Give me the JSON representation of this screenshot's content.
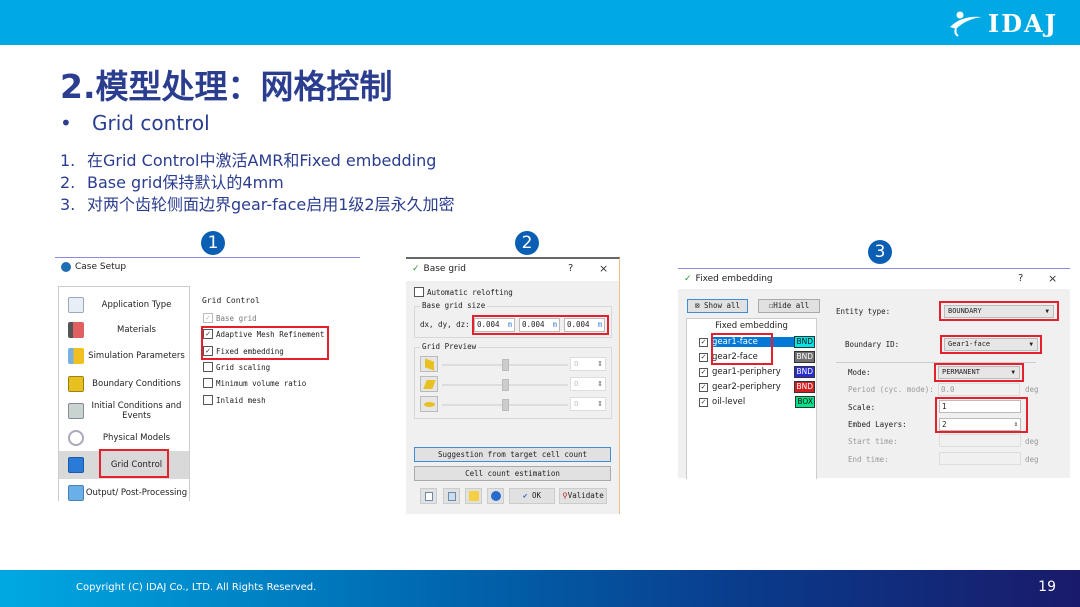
{
  "header": {
    "logo_text": "IDAJ",
    "brand_color": "#00a9e3"
  },
  "slide": {
    "title": "2.模型处理：网格控制",
    "bullet": "Grid control",
    "bullet_marker": "•",
    "steps": [
      {
        "num": "1.",
        "text": "在Grid Control中激活AMR和Fixed embedding"
      },
      {
        "num": "2.",
        "text": "Base grid保持默认的4mm"
      },
      {
        "num": "3.",
        "text": "对两个齿轮侧面边界gear-face启用1级2层永久加密"
      }
    ],
    "badges": [
      "1",
      "2",
      "3"
    ]
  },
  "case_setup": {
    "title": "Case Setup",
    "sidebar": [
      {
        "label": "Application Type",
        "icon": "notepad-icon"
      },
      {
        "label": "Materials",
        "icon": "materials-icon"
      },
      {
        "label": "Simulation Parameters",
        "icon": "folder-icon"
      },
      {
        "label": "Boundary Conditions",
        "icon": "box-icon"
      },
      {
        "label": "Initial Conditions and Events",
        "icon": "calculator-icon"
      },
      {
        "label": "Physical Models",
        "icon": "chain-icon"
      },
      {
        "label": "Grid Control",
        "icon": "grid-icon",
        "selected": true
      },
      {
        "label": "Output/ Post-Processing",
        "icon": "monitor-icon"
      }
    ],
    "group_title": "Grid Control",
    "options": [
      {
        "label": "Base grid",
        "checked": true,
        "disabled": true
      },
      {
        "label": "Adaptive Mesh Refinement",
        "checked": true
      },
      {
        "label": "Fixed embedding",
        "checked": true
      },
      {
        "label": "Grid scaling",
        "checked": false
      },
      {
        "label": "Minimum volume ratio",
        "checked": false
      },
      {
        "label": "Inlaid mesh",
        "checked": false
      }
    ]
  },
  "base_grid": {
    "title": "Base grid",
    "help": "?",
    "close": "×",
    "auto_relofting": "Automatic relofting",
    "size_group": "Base grid size",
    "size_label": "dx, dy, dz:",
    "dx": "0.004",
    "dy": "0.004",
    "dz": "0.004",
    "unit": "m",
    "preview_group": "Grid Preview",
    "preview_values": [
      "0",
      "0",
      "0"
    ],
    "preview_positions": [
      0.5,
      0.5,
      0.5
    ],
    "suggest_btn": "Suggestion from target cell count",
    "estimate_btn": "Cell count estimation",
    "ok_btn": "OK",
    "validate_btn": "Validate"
  },
  "fixed_embedding": {
    "title": "Fixed embedding",
    "help": "?",
    "close": "×",
    "show_all": "Show all",
    "hide_all": "Hide all",
    "list_header": "Fixed embedding",
    "items": [
      {
        "name": "gear1-face",
        "tag": "BND",
        "tag_color": "#00e5e5",
        "selected": true
      },
      {
        "name": "gear2-face",
        "tag": "BND",
        "tag_color": "#707070"
      },
      {
        "name": "gear1-periphery",
        "tag": "BND",
        "tag_color": "#2a2ad0"
      },
      {
        "name": "gear2-periphery",
        "tag": "BND",
        "tag_color": "#d02020"
      },
      {
        "name": "oil-level",
        "tag": "BOX",
        "tag_color": "#00e58a"
      }
    ],
    "entity_type_label": "Entity type:",
    "entity_type": "BOUNDARY",
    "boundary_id_label": "Boundary ID:",
    "boundary_id": "Gear1-face",
    "mode_label": "Mode:",
    "mode": "PERMANENT",
    "period_label": "Period (cyc. mode):",
    "period": "0.0",
    "scale_label": "Scale:",
    "scale": "1",
    "embed_layers_label": "Embed Layers:",
    "embed_layers": "2",
    "start_time_label": "Start time:",
    "end_time_label": "End time:",
    "deg": "deg"
  },
  "footer": {
    "copyright": "Copyright (C)  IDAJ Co., LTD. All Rights Reserved.",
    "page": "19"
  }
}
